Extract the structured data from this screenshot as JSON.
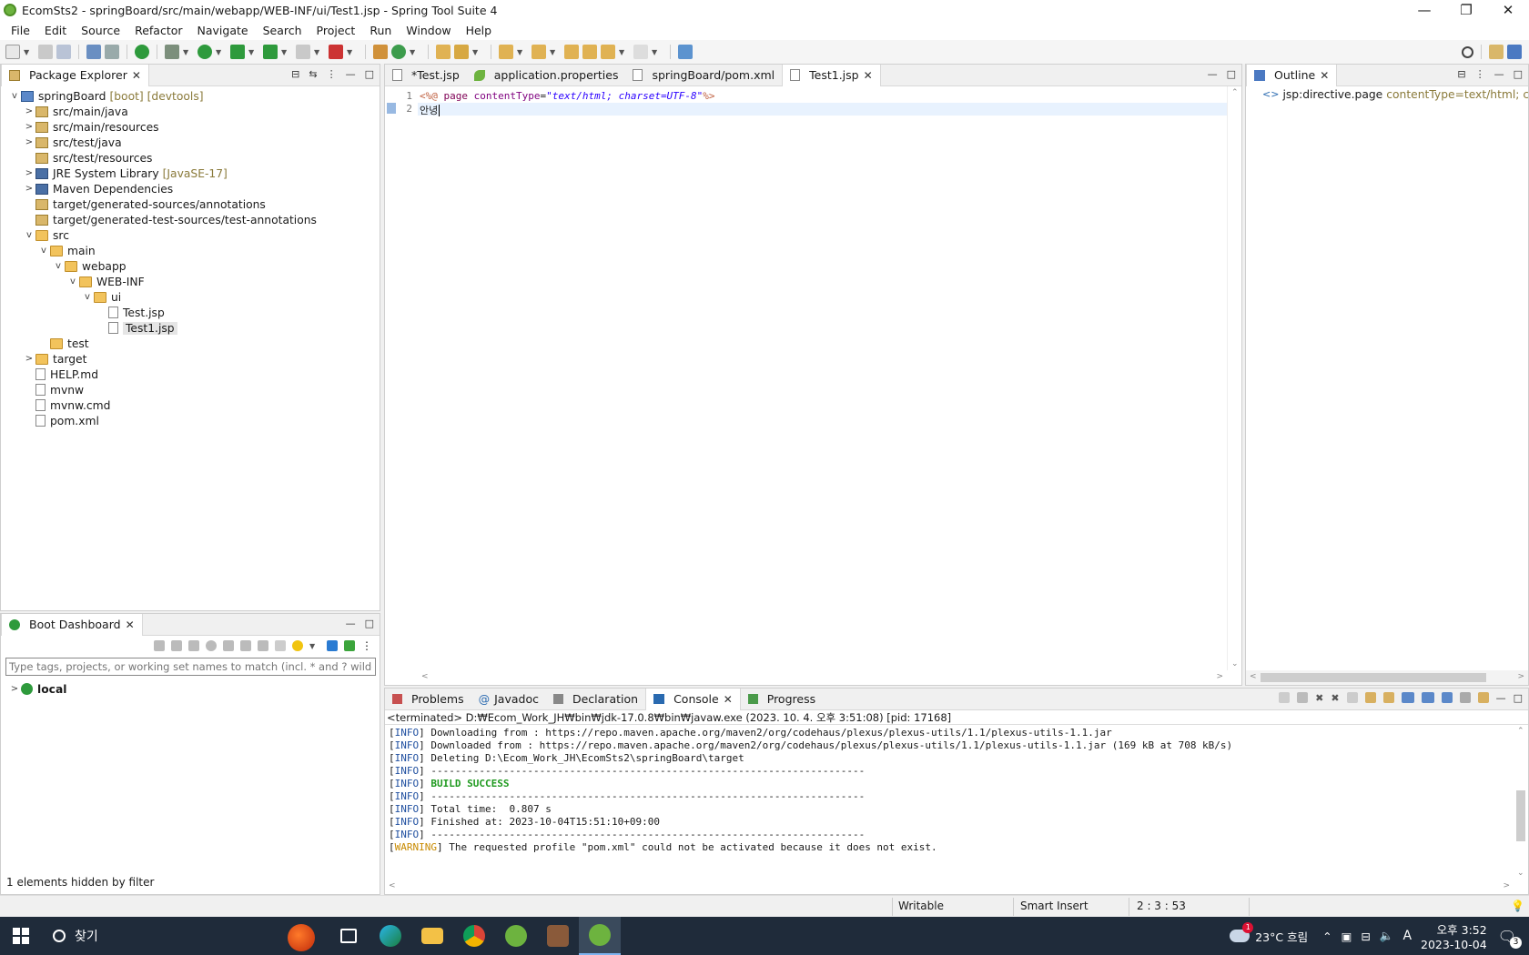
{
  "window": {
    "title": "EcomSts2 - springBoard/src/main/webapp/WEB-INF/ui/Test1.jsp - Spring Tool Suite 4",
    "minimize": "—",
    "restore": "❐",
    "close": "✕"
  },
  "menu": [
    "File",
    "Edit",
    "Source",
    "Refactor",
    "Navigate",
    "Search",
    "Project",
    "Run",
    "Window",
    "Help"
  ],
  "package_explorer": {
    "title": "Package Explorer",
    "items": [
      {
        "label": "springBoard",
        "extra": "[boot] [devtools]",
        "twisty": "v",
        "icon": "proj",
        "indent": 0
      },
      {
        "label": "src/main/java",
        "extra": "",
        "twisty": ">",
        "icon": "pkgf",
        "indent": 1
      },
      {
        "label": "src/main/resources",
        "extra": "",
        "twisty": ">",
        "icon": "pkgf",
        "indent": 1
      },
      {
        "label": "src/test/java",
        "extra": "",
        "twisty": ">",
        "icon": "pkgf",
        "indent": 1
      },
      {
        "label": "src/test/resources",
        "extra": "",
        "twisty": "",
        "icon": "pkgf",
        "indent": 1
      },
      {
        "label": "JRE System Library",
        "extra": "[JavaSE-17]",
        "twisty": ">",
        "icon": "lib",
        "indent": 1
      },
      {
        "label": "Maven Dependencies",
        "extra": "",
        "twisty": ">",
        "icon": "lib",
        "indent": 1
      },
      {
        "label": "target/generated-sources/annotations",
        "extra": "",
        "twisty": "",
        "icon": "pkgf",
        "indent": 1
      },
      {
        "label": "target/generated-test-sources/test-annotations",
        "extra": "",
        "twisty": "",
        "icon": "pkgf",
        "indent": 1
      },
      {
        "label": "src",
        "extra": "",
        "twisty": "v",
        "icon": "folder",
        "indent": 1
      },
      {
        "label": "main",
        "extra": "",
        "twisty": "v",
        "icon": "folder",
        "indent": 2
      },
      {
        "label": "webapp",
        "extra": "",
        "twisty": "v",
        "icon": "folder",
        "indent": 3
      },
      {
        "label": "WEB-INF",
        "extra": "",
        "twisty": "v",
        "icon": "folder",
        "indent": 4
      },
      {
        "label": "ui",
        "extra": "",
        "twisty": "v",
        "icon": "folder",
        "indent": 5
      },
      {
        "label": "Test.jsp",
        "extra": "",
        "twisty": "",
        "icon": "file",
        "indent": 6
      },
      {
        "label": "Test1.jsp",
        "extra": "",
        "twisty": "",
        "icon": "file",
        "indent": 6,
        "selected": true
      },
      {
        "label": "test",
        "extra": "",
        "twisty": "",
        "icon": "folder",
        "indent": 2
      },
      {
        "label": "target",
        "extra": "",
        "twisty": ">",
        "icon": "folder",
        "indent": 1
      },
      {
        "label": "HELP.md",
        "extra": "",
        "twisty": "",
        "icon": "file",
        "indent": 1
      },
      {
        "label": "mvnw",
        "extra": "",
        "twisty": "",
        "icon": "file",
        "indent": 1
      },
      {
        "label": "mvnw.cmd",
        "extra": "",
        "twisty": "",
        "icon": "file",
        "indent": 1
      },
      {
        "label": "pom.xml",
        "extra": "",
        "twisty": "",
        "icon": "file",
        "indent": 1
      }
    ]
  },
  "boot_dashboard": {
    "title": "Boot Dashboard",
    "filter_placeholder": "Type tags, projects, or working set names to match (incl. * and ? wildcards)",
    "item": "local",
    "footer": "1 elements hidden by filter"
  },
  "editor": {
    "tabs": [
      {
        "label": "*Test.jsp",
        "active": false
      },
      {
        "label": "application.properties",
        "active": false
      },
      {
        "label": "springBoard/pom.xml",
        "active": false
      },
      {
        "label": "Test1.jsp",
        "active": true
      }
    ],
    "line_numbers": [
      "1",
      "2"
    ],
    "line2": "안녕"
  },
  "outline": {
    "title": "Outline",
    "node": "jsp:directive.page",
    "attr": "contentType=text/html; charset="
  },
  "console": {
    "tabs": [
      "Problems",
      "Javadoc",
      "Declaration",
      "Console",
      "Progress"
    ],
    "header": "<terminated> D:₩Ecom_Work_JH₩bin₩jdk-17.0.8₩bin₩javaw.exe (2023. 10. 4. 오후 3:51:08) [pid: 17168]",
    "lines": [
      {
        "tag": "INFO",
        "text": " Downloading from : https://repo.maven.apache.org/maven2/org/codehaus/plexus/plexus-utils/1.1/plexus-utils-1.1.jar"
      },
      {
        "tag": "INFO",
        "text": " Downloaded from : https://repo.maven.apache.org/maven2/org/codehaus/plexus/plexus-utils/1.1/plexus-utils-1.1.jar (169 kB at 708 kB/s)"
      },
      {
        "tag": "INFO",
        "text": " Deleting D:\\Ecom_Work_JH\\EcomSts2\\springBoard\\target"
      },
      {
        "tag": "INFO",
        "text": " ------------------------------------------------------------------------"
      },
      {
        "tag": "INFO",
        "text": " BUILD SUCCESS",
        "success": true
      },
      {
        "tag": "INFO",
        "text": " ------------------------------------------------------------------------"
      },
      {
        "tag": "INFO",
        "text": " Total time:  0.807 s"
      },
      {
        "tag": "INFO",
        "text": " Finished at: 2023-10-04T15:51:10+09:00"
      },
      {
        "tag": "INFO",
        "text": " ------------------------------------------------------------------------"
      },
      {
        "tag": "WARNING",
        "text": " The requested profile \"pom.xml\" could not be activated because it does not exist."
      }
    ]
  },
  "status": {
    "writable": "Writable",
    "insert_mode": "Smart Insert",
    "position": "2 : 3 : 53"
  },
  "taskbar": {
    "search": "찾기",
    "weather": "23°C 흐림",
    "time": "오후 3:52",
    "date": "2023-10-04",
    "ime": "A",
    "notif_count": "3",
    "weather_badge": "1"
  }
}
